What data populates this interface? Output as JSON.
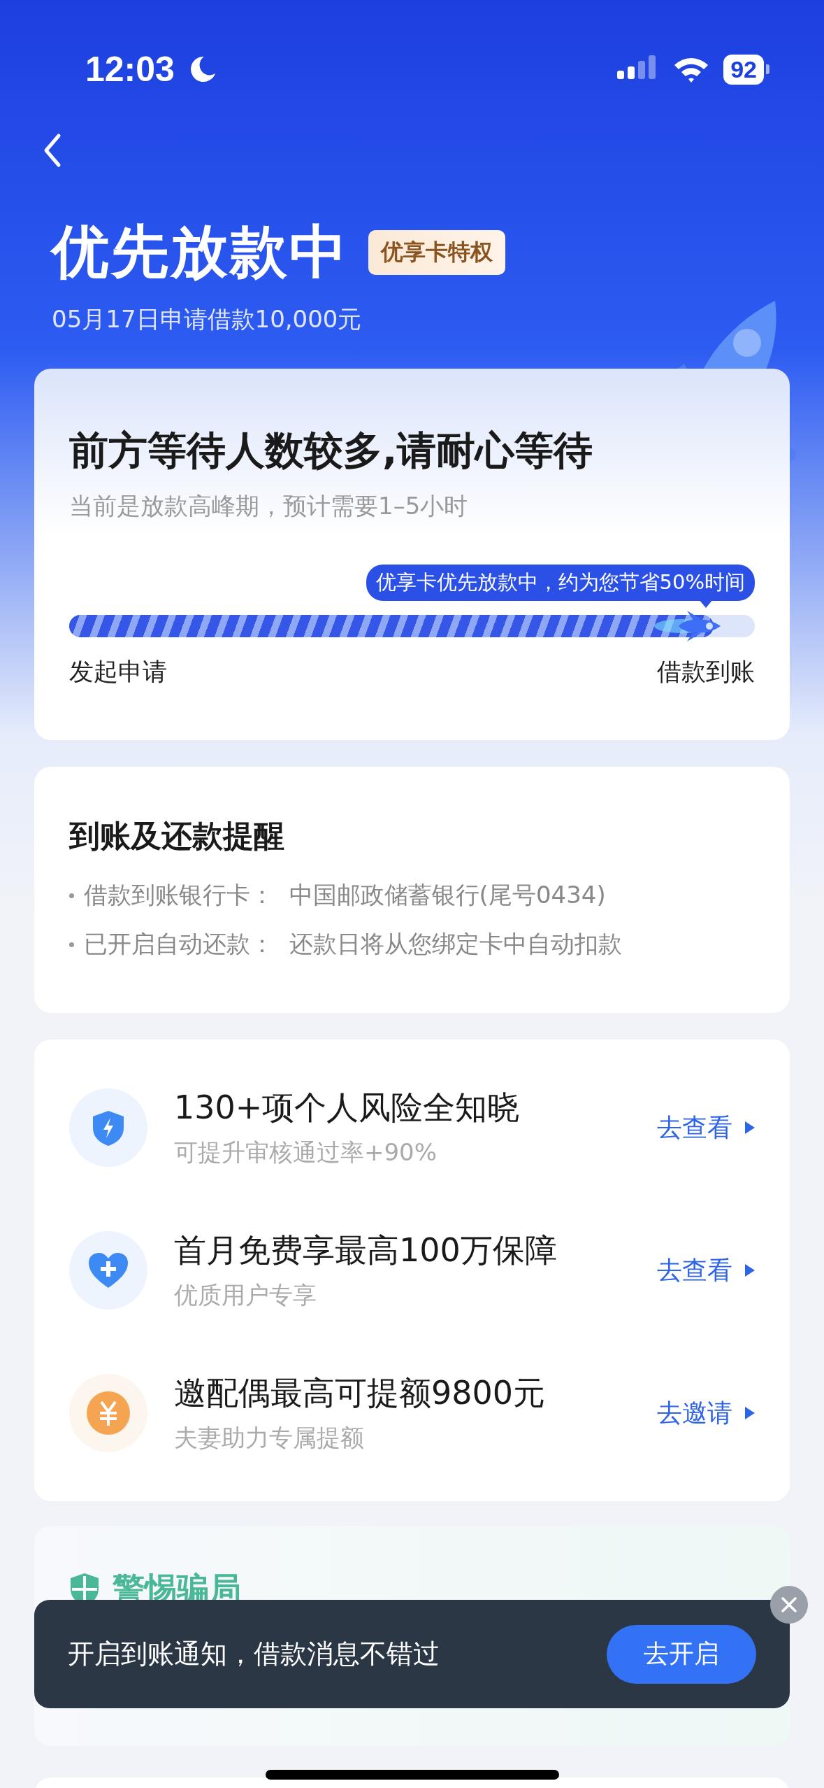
{
  "status_bar": {
    "time": "12:03",
    "battery": "92"
  },
  "header": {
    "title": "优先放款中",
    "badge": "优享卡特权",
    "subtitle": "05月17日申请借款10,000元"
  },
  "progress_card": {
    "title": "前方等待人数较多,请耐心等待",
    "subtitle": "当前是放款高峰期，预计需要1–5小时",
    "tip": "优享卡优先放款中，约为您节省50%时间",
    "level": 0.94,
    "start_label": "发起申请",
    "end_label": "借款到账"
  },
  "reminder": {
    "title": "到账及还款提醒",
    "items": [
      {
        "text": "借款到账银行卡：  中国邮政储蓄银行(尾号0434)"
      },
      {
        "text": "已开启自动还款：  还款日将从您绑定卡中自动扣款"
      }
    ]
  },
  "services": [
    {
      "kind": "shield",
      "title": "130+项个人风险全知晓",
      "subtitle": "可提升审核通过率+90%",
      "action": "去查看"
    },
    {
      "kind": "heart",
      "title": "首月免费享最高100万保障",
      "subtitle": "优质用户专享",
      "action": "去查看"
    },
    {
      "kind": "coin",
      "title": "邀配偶最高可提额9800元",
      "subtitle": "夫妻助力专属提额",
      "action": "去邀请"
    }
  ],
  "fraud_card": {
    "title": "警惕骗局"
  },
  "toast": {
    "text": "开启到账通知，借款消息不错过",
    "button": "去开启"
  }
}
